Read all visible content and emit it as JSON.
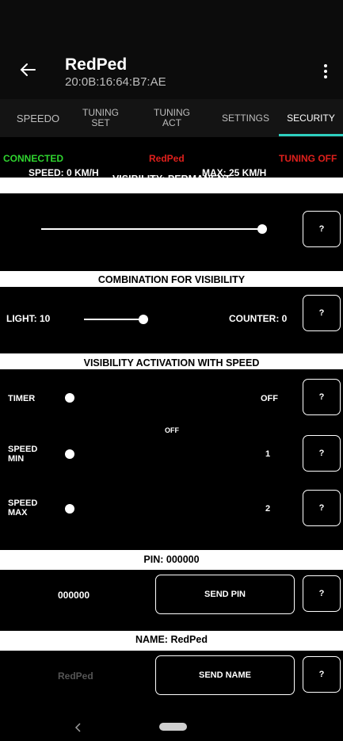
{
  "header": {
    "title": "RedPed",
    "subtitle": "20:0B:16:64:B7:AE",
    "back_icon": "back-arrow-icon",
    "menu_icon": "kebab-menu-icon"
  },
  "tabs": [
    {
      "label": "SPEEDO"
    },
    {
      "label": "TUNING\nSET"
    },
    {
      "label": "TUNING\nACT"
    },
    {
      "label": "SETTINGS"
    },
    {
      "label": "SECURITY"
    }
  ],
  "status": {
    "connected": "CONNECTED",
    "device": "RedPed",
    "tuning": "TUNING OFF",
    "speed": "SPEED: 0 KM/H",
    "max": "MAX: 25 KM/H"
  },
  "colors": {
    "connected": "#2fd52f",
    "red": "#e0201c",
    "accent": "#2ed0c0"
  },
  "visibility": {
    "label": "VISIBILITY: PERMANENT",
    "slider_level": 1.0,
    "help": "?"
  },
  "combination": {
    "label": "COMBINATION FOR VISIBILITY",
    "light": "LIGHT: 10",
    "light_level": 1.0,
    "counter": "COUNTER: 0",
    "help": "?"
  },
  "activation": {
    "label": "VISIBILITY ACTIVATION WITH SPEED",
    "timer_label": "TIMER",
    "timer_value": "OFF",
    "middle_value": "OFF",
    "speed_min_label": "SPEED\nMIN",
    "speed_min_value": "1",
    "speed_max_label": "SPEED\nMAX",
    "speed_max_value": "2",
    "help": "?"
  },
  "pin": {
    "label": "PIN: 000000",
    "value": "000000",
    "send": "SEND PIN",
    "help": "?"
  },
  "name": {
    "label": "NAME: RedPed",
    "placeholder": "RedPed",
    "send": "SEND NAME",
    "help": "?"
  },
  "navbar": {
    "back_icon": "nav-back-icon",
    "home_icon": "nav-home-pill-icon"
  }
}
